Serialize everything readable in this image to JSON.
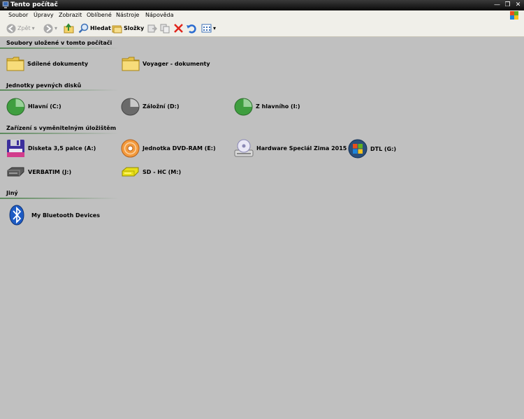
{
  "window": {
    "title": "Tento počítač"
  },
  "menu": [
    "Soubor",
    "Úpravy",
    "Zobrazit",
    "Oblíbené",
    "Nástroje",
    "Nápověda"
  ],
  "toolbar": {
    "back": "Zpět",
    "search": "Hledat",
    "folders": "Složky"
  },
  "groups": [
    {
      "title": "Soubory uložené v tomto počítači",
      "items": [
        "Sdílené dokumenty",
        "Voyager - dokumenty"
      ]
    },
    {
      "title": "Jednotky pevných disků",
      "items": [
        "Hlavní (C:)",
        "Záložní (D:)",
        "Z hlavního (I:)"
      ]
    },
    {
      "title": "Zařízení s vyměnitelným úložištěm",
      "items": [
        "Disketa 3,5 palce (A:)",
        "Jednotka DVD-RAM (E:)",
        "Hardware Speciál Zima 2015 (F:)",
        "DTL (G:)",
        "VERBATIM (J:)",
        "SD - HC (M:)"
      ]
    },
    {
      "title": "Jiný",
      "items": [
        "My Bluetooth Devices"
      ]
    }
  ],
  "icons": {
    "folder": "folder-icon",
    "hdd": "hard-drive-icon",
    "floppy": "floppy-disk-icon",
    "dvd": "dvd-drive-icon",
    "cd": "cd-drive-icon",
    "windows": "windows-logo-icon",
    "usb": "usb-drive-icon",
    "sd": "sd-card-icon",
    "bluetooth": "bluetooth-icon"
  }
}
